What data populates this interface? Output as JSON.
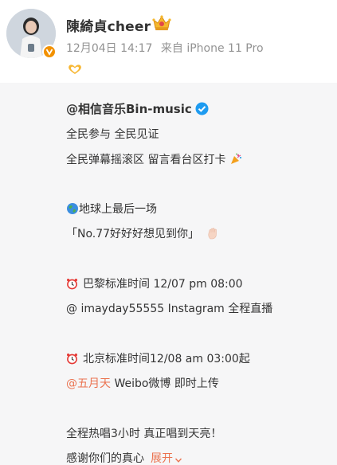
{
  "post": {
    "username": "陳綺貞cheer",
    "date": "12月04日 14:17",
    "source": "来自 iPhone 11 Pro"
  },
  "content": {
    "account": "@相信音乐Bin-music",
    "line1": "全民参与 全民见证",
    "line2": "全民弹幕摇滚区 留言看台区打卡",
    "line3": "地球上最后一场",
    "line4": "「No.77好好好想见到你」",
    "line5": "巴黎标准时间 12/07 pm 08:00",
    "line6": "@ imayday55555 Instagram 全程直播",
    "line7": "北京标准时间12/08 am 03:00起",
    "line8_mention": "@五月天",
    "line8_rest": " Weibo微博 即时上传",
    "line9": "全程热唱3小时 真正唱到天亮！",
    "line10": "感谢你们的真心",
    "expand_label": "展开"
  },
  "icons": {
    "avatar": "avatar-photo",
    "verified": "verified-badge-icon",
    "crown": "crown-badge-icon",
    "heart_hands": "heart-hands-icon",
    "blue_check": "blue-verified-icon",
    "party": "party-popper-icon",
    "globe": "globe-icon",
    "wave": "waving-hand-icon",
    "alarm": "alarm-clock-icon"
  },
  "colors": {
    "username": "#333333",
    "meta": "#939393",
    "mention": "#eb7350",
    "panel": "#f6f6f7",
    "orange_badge": "#f29100",
    "blue_check": "#1e9bf0"
  }
}
